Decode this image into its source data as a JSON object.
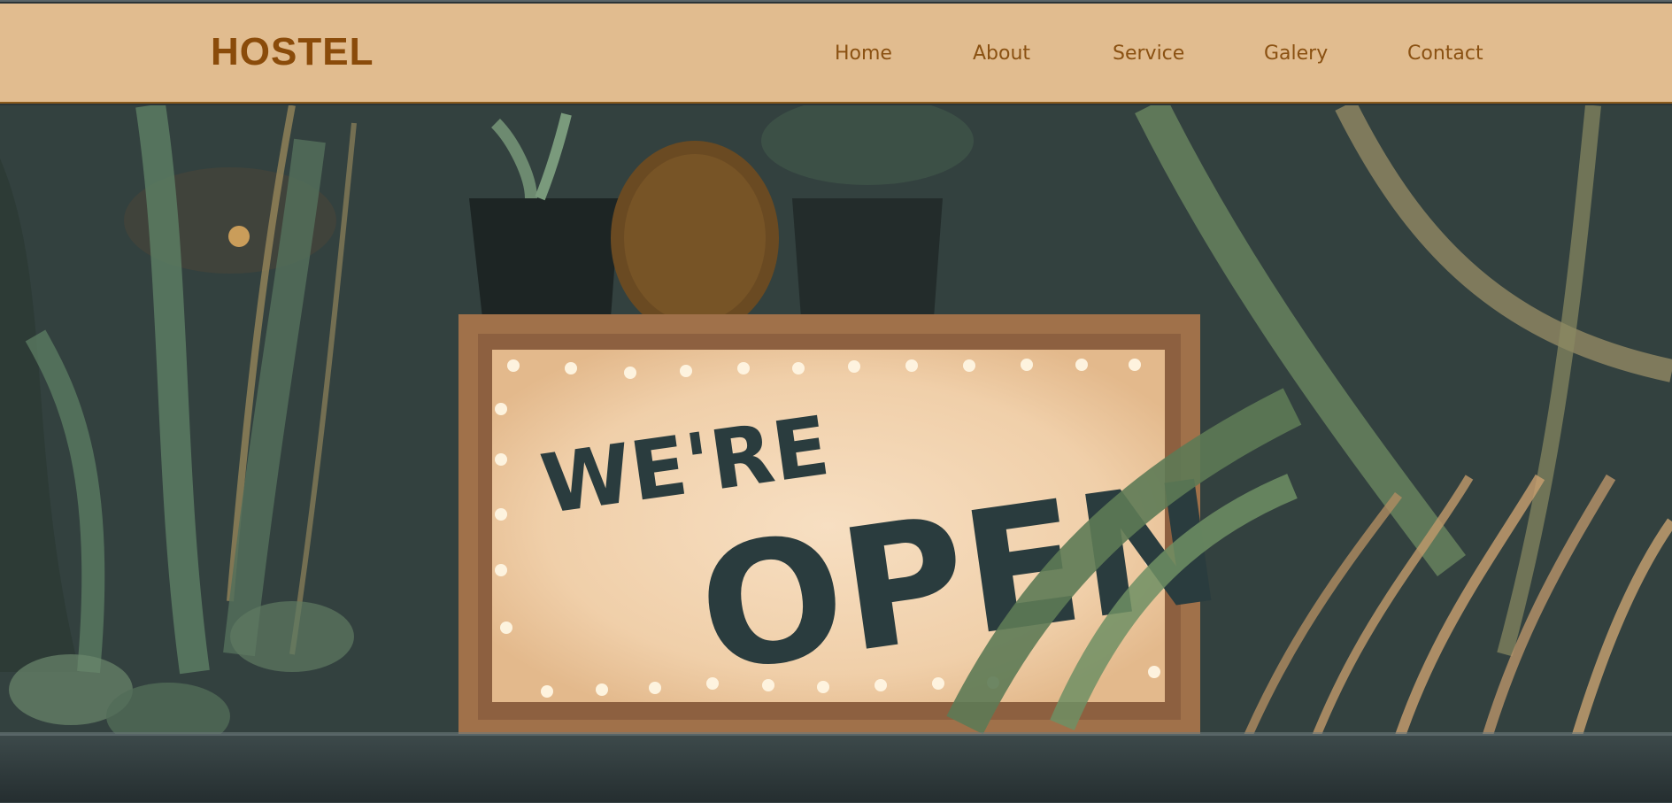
{
  "brand": {
    "name": "HOSTEL"
  },
  "nav": {
    "items": [
      {
        "label": "Home"
      },
      {
        "label": "About"
      },
      {
        "label": "Service"
      },
      {
        "label": "Galery"
      },
      {
        "label": "Contact"
      }
    ]
  },
  "hero": {
    "image": {
      "sign_line1": "WE'RE",
      "sign_line2": "OPEN"
    }
  },
  "colors": {
    "nav_bg": "#e1bc8f",
    "brand": "#8a4b0a",
    "nav_text": "#8a5112",
    "nav_border": "#8a5a1c"
  },
  "icons": [
    "hero-photo"
  ]
}
